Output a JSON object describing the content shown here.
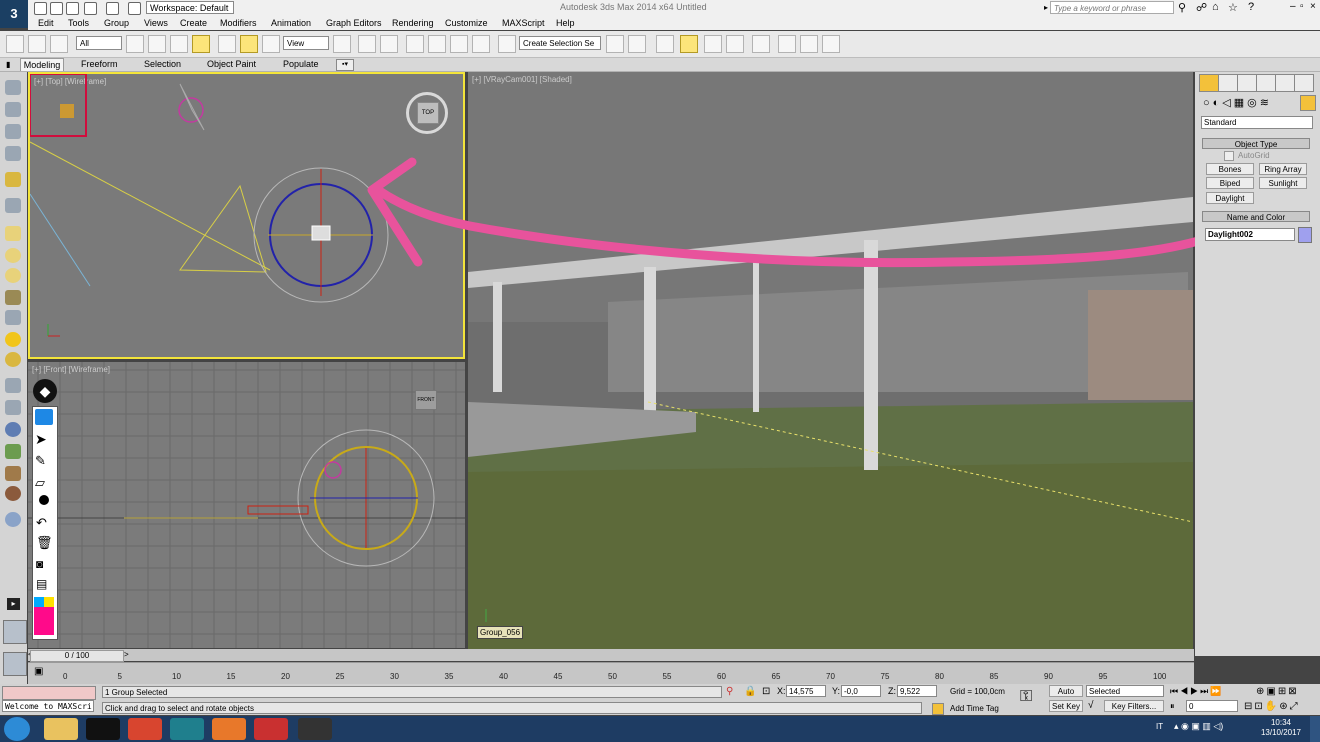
{
  "window": {
    "title": "Autodesk 3ds Max 2014 x64    Untitled",
    "workspace": "Workspace: Default",
    "search_placeholder": "Type a keyword or phrase"
  },
  "menu": [
    "Edit",
    "Tools",
    "Group",
    "Views",
    "Create",
    "Modifiers",
    "Animation",
    "Graph Editors",
    "Rendering",
    "Customize",
    "MAXScript",
    "Help"
  ],
  "toolbar": {
    "selection_filter": "All",
    "ref_coord": "View",
    "named_selection": "Create Selection Se"
  },
  "ribbon": {
    "tabs": [
      "Modeling",
      "Freeform",
      "Selection",
      "Object Paint",
      "Populate"
    ]
  },
  "viewports": {
    "top_label": "[+] [Top] [Wireframe]",
    "front_label": "[+] [Front] [Wireframe]",
    "camera_label": "[+] [VRayCam001] [Shaded]",
    "viewcube_top": "TOP",
    "viewcube_front": "FRONT",
    "camera_object_tag": "Group_056"
  },
  "command_panel": {
    "category": "Standard",
    "rollout_object_type": "Object Type",
    "autogrid_label": "AutoGrid",
    "buttons": [
      "Bones",
      "Ring Array",
      "Biped",
      "Sunlight",
      "Daylight"
    ],
    "rollout_name_color": "Name and Color",
    "object_name": "Daylight002",
    "object_color": "#9fa0ee"
  },
  "timeline": {
    "current": "0 / 100",
    "ticks": [
      "0",
      "5",
      "10",
      "15",
      "20",
      "25",
      "30",
      "35",
      "40",
      "45",
      "50",
      "55",
      "60",
      "65",
      "70",
      "75",
      "80",
      "85",
      "90",
      "95",
      "100"
    ]
  },
  "status": {
    "maxscript_prompt": "Welcome to MAXScri",
    "selection_info": "1 Group Selected",
    "prompt": "Click and drag to select and rotate objects",
    "x_label": "X:",
    "x": "14,575",
    "y_label": "Y:",
    "y": "-0,0",
    "z_label": "Z:",
    "z": "9,522",
    "grid": "Grid = 100,0cm",
    "add_time_tag": "Add Time Tag",
    "auto_key": "Auto Key",
    "set_key": "Set Key",
    "key_mode": "Selected",
    "key_filters": "Key Filters...",
    "frame": "0"
  },
  "taskbar": {
    "lang": "IT",
    "time": "10:34",
    "date": "13/10/2017"
  },
  "colors": {
    "annotation": "#e8539c",
    "viewport_active_border": "#f3e43a"
  }
}
